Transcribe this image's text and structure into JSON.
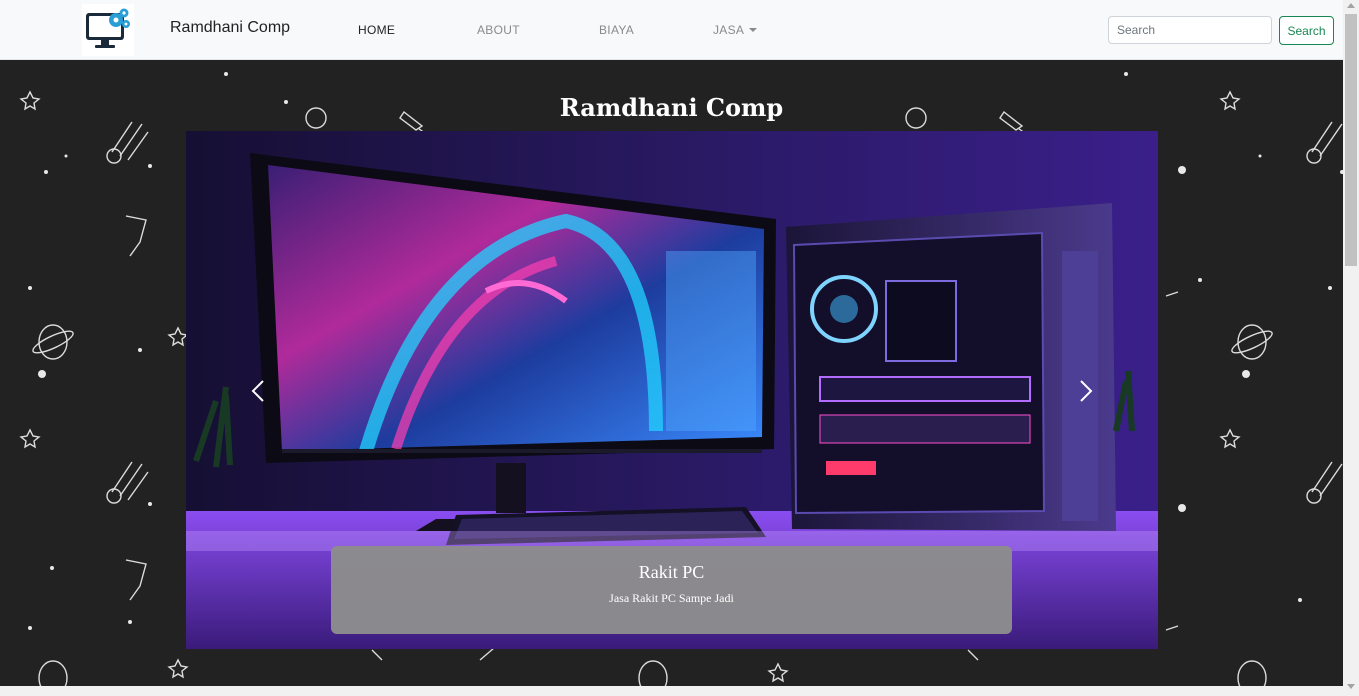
{
  "navbar": {
    "brand": "Ramdhani Comp",
    "links": [
      {
        "label": "HOME",
        "active": true
      },
      {
        "label": "ABOUT",
        "active": false
      },
      {
        "label": "BIAYA",
        "active": false
      },
      {
        "label": "JASA",
        "active": false,
        "dropdown": true
      }
    ],
    "search_placeholder": "Search",
    "search_button": "Search",
    "logo_icon": "monitor-gears-icon"
  },
  "hero": {
    "title": "Ramdhani Comp"
  },
  "carousel": {
    "caption_title": "Rakit PC",
    "caption_text": "Jasa Rakit PC Sampe Jadi",
    "slide_count": 3,
    "active_slide": 0,
    "prev_icon": "chevron-left-icon",
    "next_icon": "chevron-right-icon"
  },
  "colors": {
    "navbar_bg": "#f8f9fa",
    "hero_bg": "#222222",
    "search_button": "#198754",
    "caption_bg": "#8c8c8c"
  }
}
